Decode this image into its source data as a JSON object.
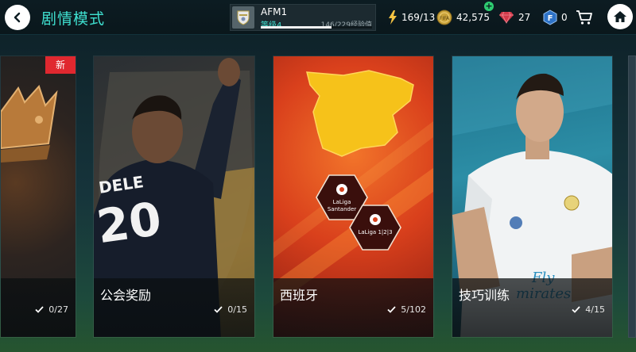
{
  "header": {
    "title": "剧情模式",
    "profile": {
      "username": "AFM1",
      "level": "等级4",
      "xp_text": "146/229经验值",
      "xp_progress": 0.638
    },
    "stats": {
      "energy": "169/13",
      "coins": "42,575",
      "gems": "27",
      "fifa_points": "0"
    },
    "icons": {
      "back": "back-arrow-icon",
      "energy": "lightning-icon",
      "coins": "coin-icon",
      "gems": "gem-icon",
      "points": "fifa-points-icon",
      "cart": "shopping-cart-icon",
      "home": "home-icon",
      "add": "plus-icon"
    }
  },
  "cards": [
    {
      "label": "",
      "progress": "0/27",
      "badge": "新",
      "art": "crown-emblem"
    },
    {
      "label": "公会奖励",
      "progress": "0/15",
      "art": "player-deele-20"
    },
    {
      "label": "西班牙",
      "progress": "5/102",
      "art": "spain-map-laliga"
    },
    {
      "label": "技巧训练",
      "progress": "4/15",
      "art": "player-real-madrid"
    }
  ],
  "laliga": {
    "badge1_line1": "LaLiga",
    "badge1_line2": "Santander",
    "badge2_line1": "LaLiga",
    "badge2_line2": "1|2|3"
  },
  "player_jersey": {
    "name": "DELE",
    "number": "20"
  },
  "colors": {
    "accent": "#3fe0d0",
    "new_badge": "#e0282f",
    "spain_card": "#d9401c",
    "spain_map": "#f6c21a"
  }
}
